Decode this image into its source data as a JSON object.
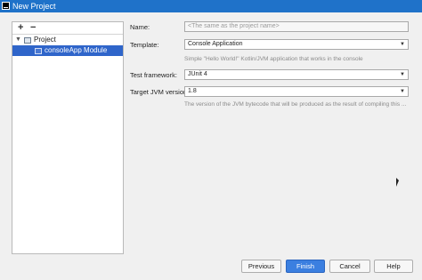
{
  "window": {
    "title": "New Project"
  },
  "tree": {
    "add_label": "+",
    "remove_label": "−",
    "items": [
      {
        "label": "Project"
      },
      {
        "label": "consoleApp Module"
      }
    ]
  },
  "form": {
    "name_label": "Name:",
    "name_placeholder": "<The same as the project name>",
    "template_label": "Template:",
    "template_value": "Console Application",
    "template_hint": "Simple \"Hello World!\" Kotlin/JVM application that works in the console",
    "test_label": "Test framework:",
    "test_value": "JUnit 4",
    "jvm_label": "Target JVM version:",
    "jvm_value": "1.8",
    "jvm_hint": "The version of the JVM bytecode that will be produced as the result of compiling this ..."
  },
  "buttons": {
    "previous": "Previous",
    "finish": "Finish",
    "cancel": "Cancel",
    "help": "Help"
  },
  "colors": {
    "accent": "#3b7fe0",
    "selection": "#2f65ca",
    "titlebar": "#1f72c9"
  }
}
